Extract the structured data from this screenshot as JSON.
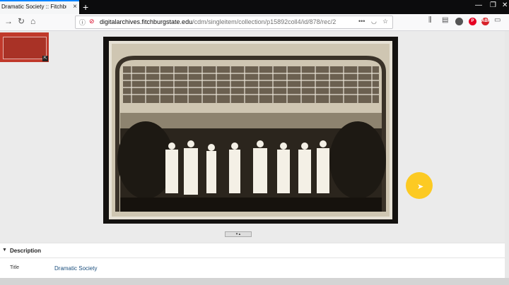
{
  "browser": {
    "tab_title": "Dramatic Society :: Fitchburg St",
    "tab_close": "×",
    "new_tab": "+",
    "window_controls": [
      "—",
      "❐",
      "✕"
    ],
    "url_host": "digitalarchives.fitchburgstate.edu",
    "url_path": "/cdm/singleitem/collection/p15892coll4/id/878/rec/2",
    "url_menu": "•••",
    "toolbar_icons": [
      "library-icon",
      "sidebar-icon",
      "account-icon",
      "pinterest-icon",
      "abp-icon",
      "screenshot-icon",
      "monitor-icon"
    ],
    "abp_label": "ABP"
  },
  "viewer": {
    "splitter_label": "▾ ▴",
    "thumb_badge": "⇱"
  },
  "description": {
    "section_label": "Description",
    "arrow": "▼",
    "fields": [
      {
        "label": "Title",
        "value": "Dramatic Society"
      }
    ]
  },
  "colors": {
    "accent": "#0a84ff",
    "link": "#1a4e7d",
    "cursor_halo": "#ffc400"
  }
}
